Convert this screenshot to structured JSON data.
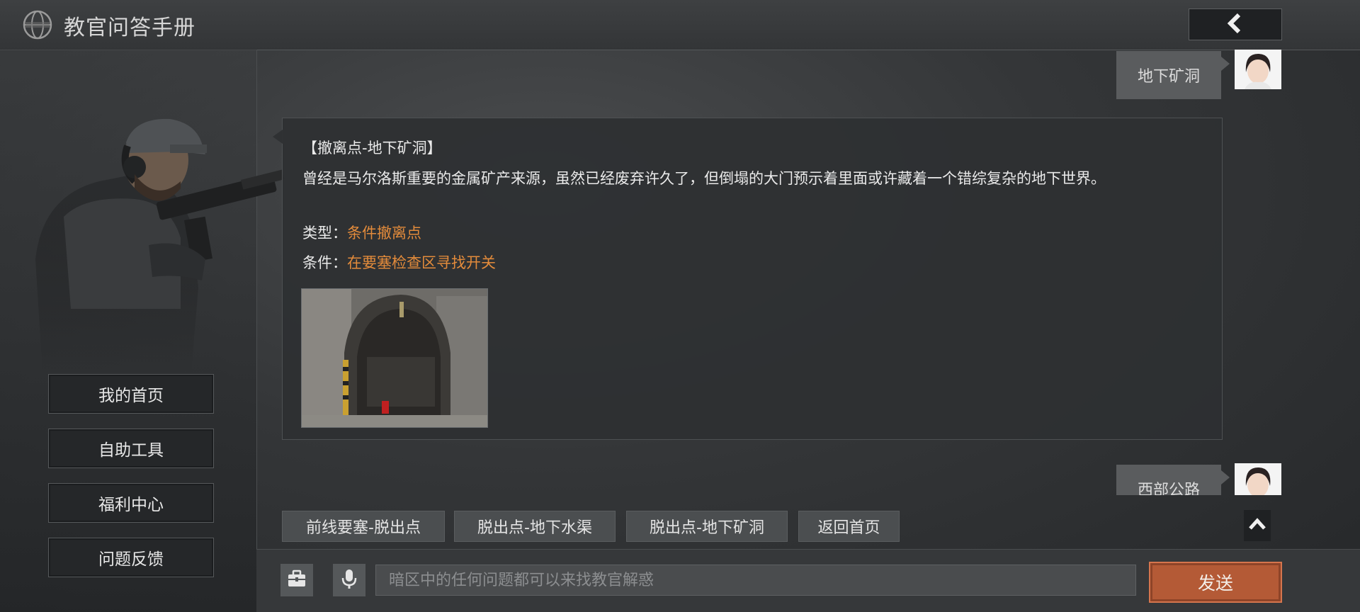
{
  "header": {
    "title": "教官问答手册",
    "icon": "globe-icon",
    "back_icon": "chevron-left-icon"
  },
  "sidebar": {
    "items": [
      {
        "label": "我的首页"
      },
      {
        "label": "自助工具"
      },
      {
        "label": "福利中心"
      },
      {
        "label": "问题反馈"
      }
    ]
  },
  "chat": {
    "user_messages": [
      {
        "text": "地下矿洞"
      },
      {
        "text": "西部公路"
      }
    ],
    "bot_message": {
      "heading": "【撤离点-地下矿洞】",
      "body": "曾经是马尔洛斯重要的金属矿产来源，虽然已经废弃许久了，但倒塌的大门预示着里面或许藏着一个错综复杂的地下世界。",
      "type_label": "类型：",
      "type_value": "条件撤离点",
      "condition_label": "条件：",
      "condition_value": "在要塞检查区寻找开关"
    }
  },
  "quick_replies": [
    {
      "label": "前线要塞-脱出点"
    },
    {
      "label": "脱出点-地下水渠"
    },
    {
      "label": "脱出点-地下矿洞"
    },
    {
      "label": "返回首页"
    }
  ],
  "input": {
    "placeholder": "暗区中的任何问题都可以来找教官解惑",
    "value": ""
  },
  "send_label": "发送",
  "colors": {
    "accent": "#e38b3b",
    "send": "#b45a36"
  }
}
